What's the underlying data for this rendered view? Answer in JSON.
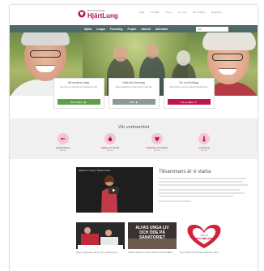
{
  "header": {
    "logo_small": "Riksförbundet",
    "logo_big": "HjärtLung",
    "top_links": [
      "Stöd",
      "Kontakt",
      "Press",
      "Om oss",
      "Bli medlem",
      "Engelska"
    ]
  },
  "nav": {
    "items": [
      "Hjärta",
      "Lungor",
      "Forskning",
      "Projekt",
      "Aktuellt",
      "Aktiviteter"
    ],
    "search_placeholder": "Sök"
  },
  "promos": [
    {
      "title": "Bli medlem idag",
      "desc": "Gå med i ett nätverk som arbetar för dig",
      "button": "Bli medlem",
      "color": "#5ba24b",
      "icon": "arrow-icon"
    },
    {
      "title": "Hitta din förening",
      "desc": "Hitta lokalförening eller distrikt nära dig",
      "button": "Hitta",
      "color": "#8a9a98",
      "icon": "arrow-icon"
    },
    {
      "title": "Ge a ett bidrag",
      "desc": "Stöd arbetet med en gåva till forskningen",
      "button": "Ge en gåva",
      "color": "#c0154f",
      "icon": "heart-icon"
    }
  ],
  "verksamhet": {
    "title": "Vår verksamhet",
    "items": [
      {
        "label": "Hjärtsjukdom",
        "sub": "Läs mer"
      },
      {
        "label": "Hälsa och livsstil",
        "sub": "Läs mer"
      },
      {
        "label": "Diabetes och hjärta",
        "sub": "Läs mer"
      },
      {
        "label": "Forskning",
        "sub": "Läs mer"
      }
    ]
  },
  "video": {
    "title": "Hjärtan & lungor Tillsammans",
    "heading": "Tillsammans är vi starka"
  },
  "cards": [
    {
      "caption": "Hjärt-Lungfonden: det här gör vi tillsammans"
    },
    {
      "caption": "ALVAS UNGA LIV OCH ÖDE PÅ SANATORIET"
    },
    {
      "caption": "Vem är årets hjärt-lungambassadör 2014?"
    }
  ],
  "colors": {
    "brand": "#b0124a",
    "nav": "#4f6a66"
  }
}
